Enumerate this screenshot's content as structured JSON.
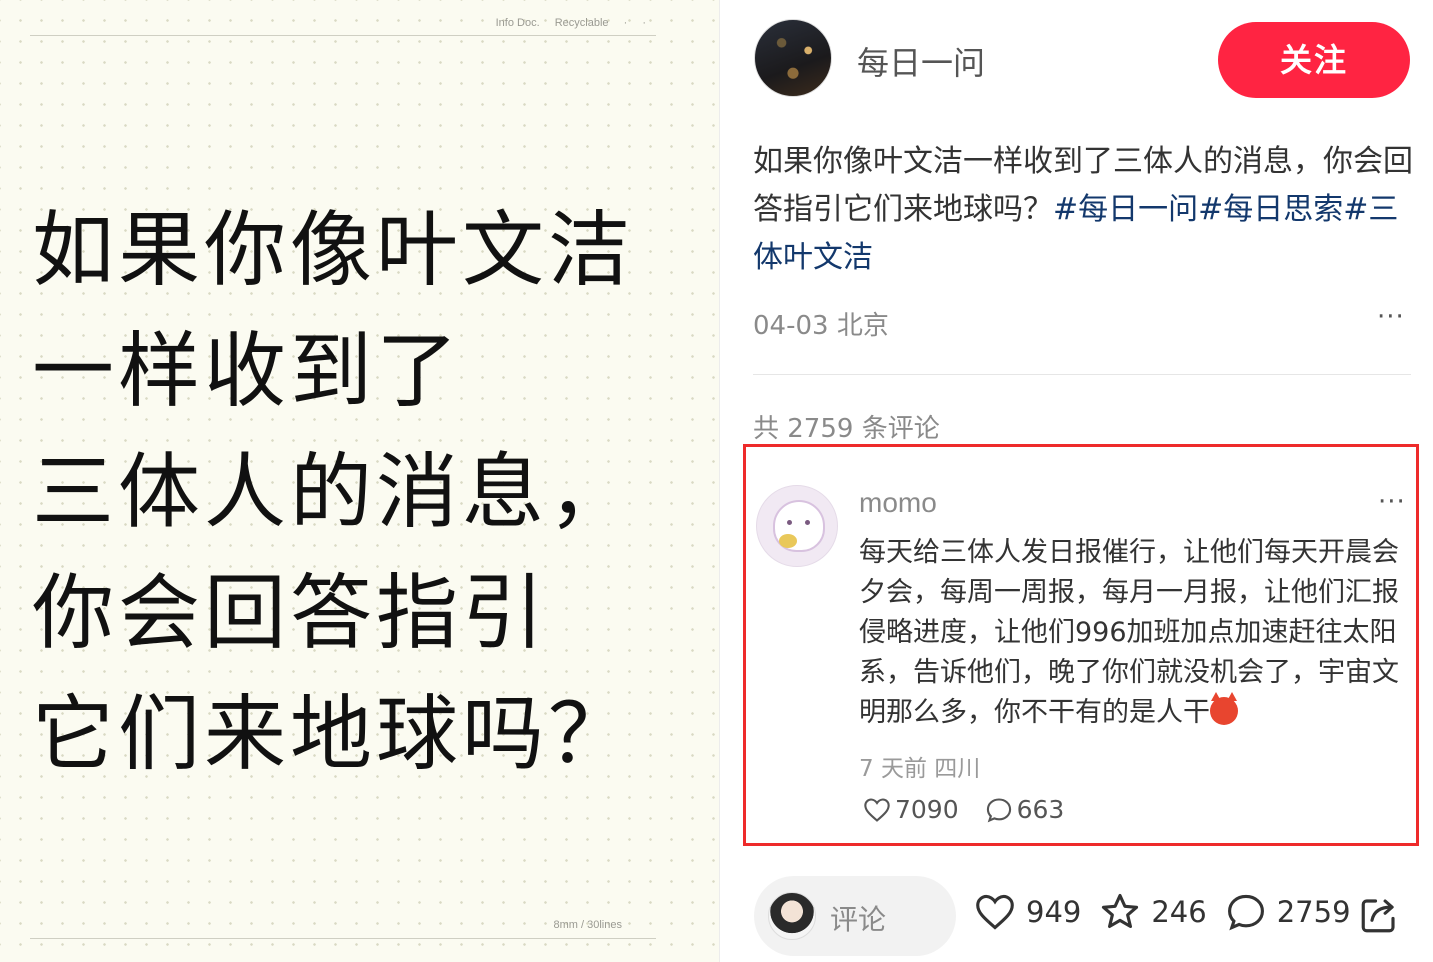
{
  "note_image": {
    "header_meta": [
      "Info Doc.",
      "Recyclable",
      "·",
      "·"
    ],
    "lines": [
      "如果你像叶文洁",
      "一样收到了",
      "三体人的消息，",
      "你会回答指引",
      "它们来地球吗？"
    ],
    "footer_meta": "8mm / 30lines"
  },
  "author": {
    "name": "每日一问",
    "follow_label": "关注"
  },
  "post": {
    "text": "如果你像叶文洁一样收到了三体人的消息，你会回答指引它们来地球吗？",
    "tags": [
      "#每日一问",
      "#每日思索",
      "#三体叶文洁"
    ],
    "meta": "04-03 北京",
    "more": "···"
  },
  "comments": {
    "count_label": "共 2759 条评论",
    "top": {
      "user": "momo",
      "more": "···",
      "text": "每天给三体人发日报催行，让他们每天开晨会夕会，每周一周报，每月一月报，让他们汇报侵略进度，让他们996加班加点加速赶往太阳系，告诉他们，晚了你们就没机会了，宇宙文明那么多，你不干有的是人干",
      "emoji": "devil-emoji",
      "meta": "7 天前 四川",
      "likes": "7090",
      "replies": "663"
    }
  },
  "bottom_bar": {
    "comment_placeholder": "评论",
    "likes": "949",
    "collects": "246",
    "comments": "2759"
  },
  "colors": {
    "accent": "#ff2442",
    "tag": "#13386c",
    "highlight_border": "#ee2a2a"
  },
  "icons": [
    "heart-icon",
    "comment-icon",
    "star-icon",
    "share-icon",
    "more-icon"
  ]
}
